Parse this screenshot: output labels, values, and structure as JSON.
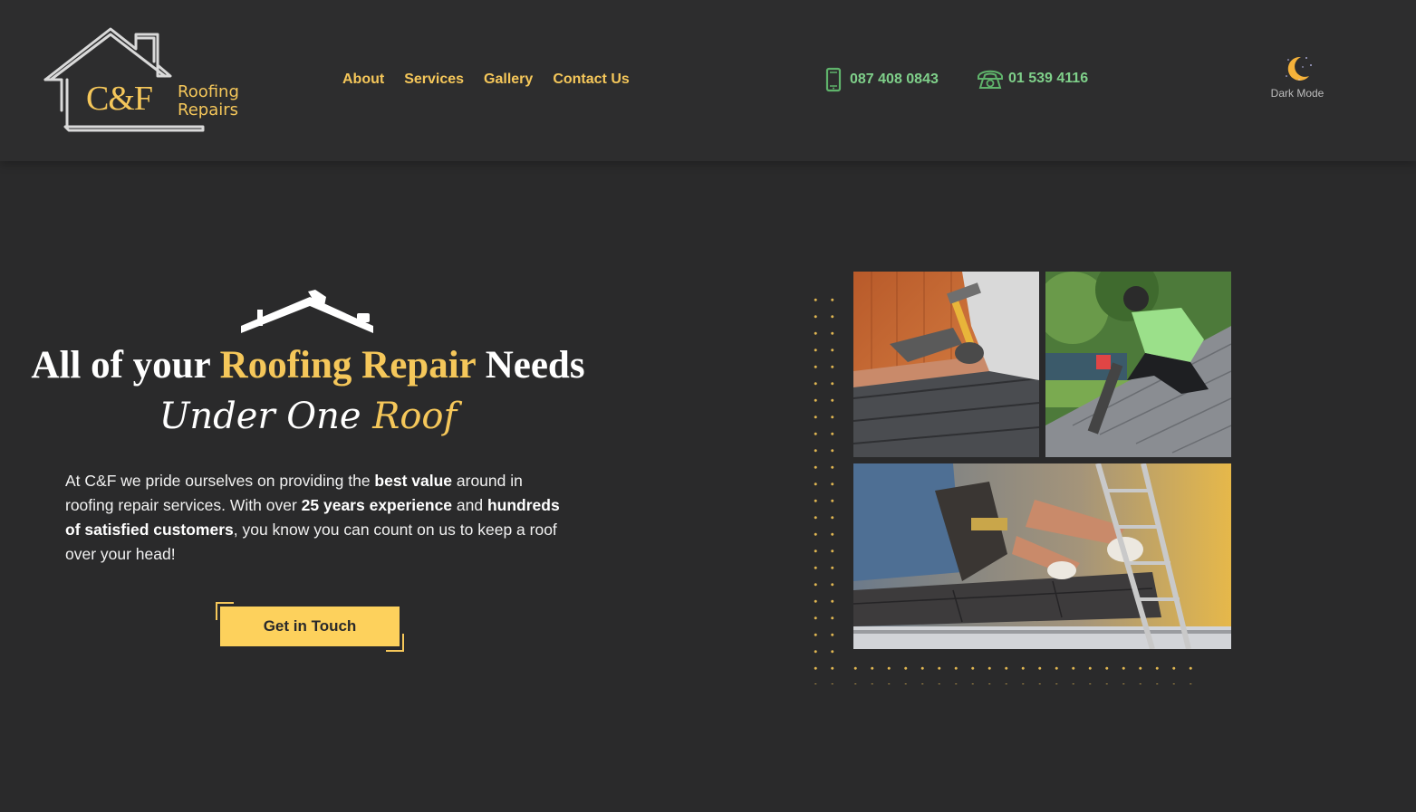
{
  "header": {
    "logo": {
      "initials": "C&F",
      "line1": "Roofing",
      "line2": "Repairs"
    },
    "nav": [
      {
        "label": "About"
      },
      {
        "label": "Services"
      },
      {
        "label": "Gallery"
      },
      {
        "label": "Contact Us"
      }
    ],
    "phones": {
      "mobile": "087 408 0843",
      "landline": "01 539 4116"
    },
    "dark_mode_label": "Dark Mode"
  },
  "hero": {
    "headline_pre": "All of your ",
    "headline_highlight": "Roofing Repair",
    "headline_post": " Needs",
    "tagline_pre": "Under One ",
    "tagline_highlight": "Roof",
    "intro": {
      "t1": "At C&F we pride ourselves on providing the ",
      "b1": "best value",
      "t2": " around in roofing repair services. With over ",
      "b2": "25 years experience",
      "t3": " and ",
      "b3": "hundreds of satisfied customers",
      "t4": ", you know you can count on us to keep a roof over your head!"
    },
    "cta_label": "Get in Touch"
  },
  "icons": {
    "mobile": "mobile-phone-icon",
    "landline": "telephone-icon",
    "dark_mode": "crescent-moon-icon",
    "roof": "roof-icon"
  },
  "colors": {
    "accent": "#f5c75a",
    "phone": "#7fd08a",
    "background": "#2a2a2b",
    "header": "#2d2d2e",
    "button": "#fdd15c"
  }
}
